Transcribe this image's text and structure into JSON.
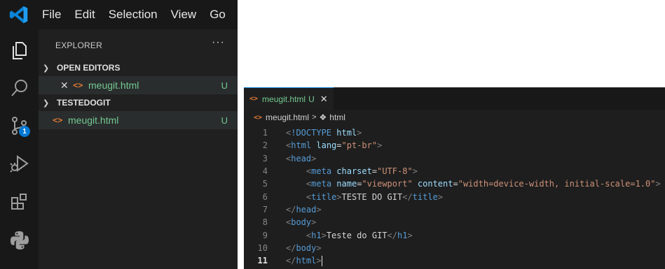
{
  "menubar": {
    "logo_icon": "vscode-logo-icon",
    "items": [
      "File",
      "Edit",
      "Selection",
      "View",
      "Go"
    ]
  },
  "activity_bar": {
    "icons": [
      "explorer-icon",
      "search-icon",
      "source-control-icon",
      "run-debug-icon",
      "extensions-icon",
      "python-icon"
    ],
    "scm_badge": "1"
  },
  "sidebar": {
    "title": "EXPLORER",
    "more_label": "···",
    "open_editors": {
      "label": "OPEN EDITORS",
      "files": [
        {
          "name": "meugit.html",
          "status": "U"
        }
      ]
    },
    "folder": {
      "label": "TESTEDOGIT",
      "files": [
        {
          "name": "meugit.html",
          "status": "U"
        }
      ]
    }
  },
  "editor": {
    "tab": {
      "name": "meugit.html",
      "status": "U"
    },
    "breadcrumb": {
      "file": "meugit.html",
      "element": "html"
    },
    "current_line": 11,
    "lines": [
      "<!DOCTYPE html>",
      "<html lang=\"pt-br\">",
      "<head>",
      "    <meta charset=\"UTF-8\">",
      "    <meta name=\"viewport\" content=\"width=device-width, initial-scale=1.0\">",
      "    <title>TESTE DO GIT</title>",
      "</head>",
      "<body>",
      "    <h1>Teste do GIT</h1>",
      "</body>",
      "</html>"
    ]
  },
  "colors": {
    "git_untracked": "#73c991",
    "html_icon": "#e37933",
    "accent": "#0078d4"
  }
}
